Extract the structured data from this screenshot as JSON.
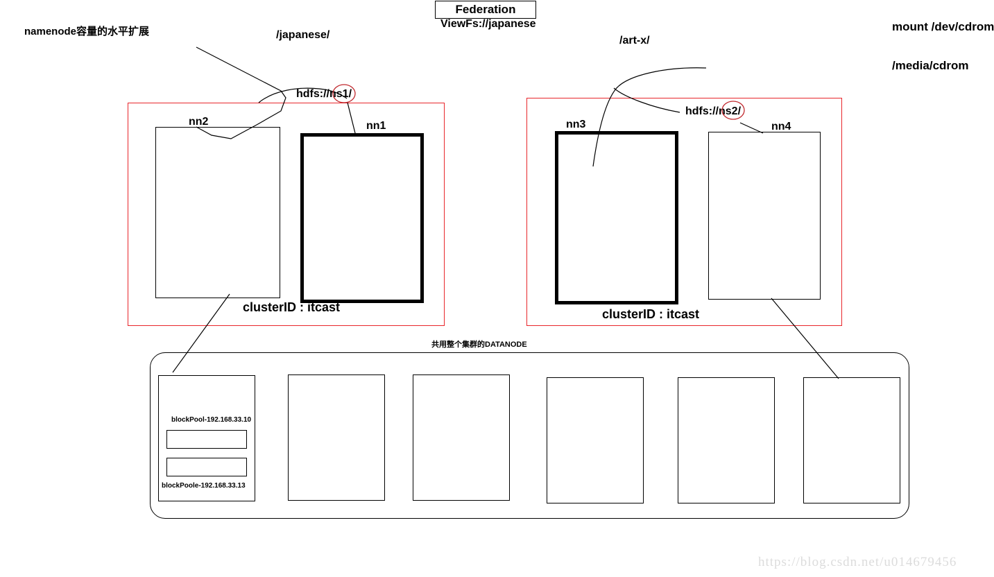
{
  "diagram": {
    "title_box": {
      "label": "Federation"
    },
    "viewfs_label": "ViewFs://japanese",
    "notes": {
      "scaling_note": "namenode容量的水平扩展",
      "japanese_path": "/japanese/",
      "artx_path": "/art-x/",
      "mount_cmd": "mount /dev/cdrom",
      "mount_point": "/media/cdrom",
      "datanode_note": "共用整个集群的DATANODE"
    },
    "namespaces": [
      {
        "id": "ns1",
        "uri": "hdfs://ns1 /",
        "uri_prefix": "hdfs://",
        "uri_circled": "ns1",
        "uri_suffix": "/",
        "clusterid_label": "clusterID  :  itcast",
        "namenodes": [
          {
            "name": "nn2",
            "style": "thin"
          },
          {
            "name": "nn1",
            "style": "thick"
          }
        ]
      },
      {
        "id": "ns2",
        "uri": "hdfs://ns2 /",
        "uri_prefix": "hdfs://",
        "uri_circled": "ns2",
        "uri_suffix": "/",
        "clusterid_label": "clusterID  :  itcast",
        "namenodes": [
          {
            "name": "nn3",
            "style": "thick"
          },
          {
            "name": "nn4",
            "style": "thin"
          }
        ]
      }
    ],
    "datanodes": [
      {
        "index": 1,
        "block_pools": [
          {
            "label": "blockPool-192.168.33.10",
            "position": "top"
          },
          {
            "label": "blockPoole-192.168.33.13",
            "position": "bottom"
          }
        ]
      },
      {
        "index": 2,
        "block_pools": []
      },
      {
        "index": 3,
        "block_pools": []
      },
      {
        "index": 4,
        "block_pools": []
      },
      {
        "index": 5,
        "block_pools": []
      },
      {
        "index": 6,
        "block_pools": []
      }
    ],
    "watermark": "https://blog.csdn.net/u014679456",
    "colors": {
      "namespace_border": "#e8252a",
      "circle_highlight": "#c0282d",
      "line": "#000000",
      "watermark": "#dcdcdc"
    }
  }
}
